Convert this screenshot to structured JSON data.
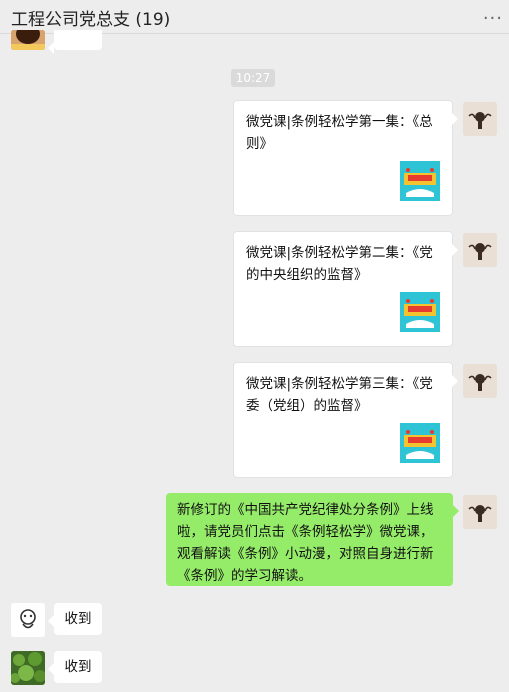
{
  "header": {
    "title": "工程公司党总支 (19)",
    "more_icon": "more-dots-icon"
  },
  "timestamp": "10:27",
  "messages": [
    {
      "text": "微党课|条例轻松学第一集：《总则》",
      "thumbnail_icon": "course-thumbnail-icon"
    },
    {
      "text": "微党课|条例轻松学第二集：《党的中央组织的监督》",
      "thumbnail_icon": "course-thumbnail-icon"
    },
    {
      "text": "微党课|条例轻松学第三集：《党委（党组）的监督》",
      "thumbnail_icon": "course-thumbnail-icon"
    },
    {
      "text": "新修订的《中国共产党纪律处分条例》上线啦，请党员们点击《条例轻松学》微党课，观看解读《条例》小动漫，对照自身进行新《条例》的学习解读。"
    },
    {
      "text": "收到"
    },
    {
      "text": "收到"
    }
  ],
  "colors": {
    "background": "#ededed",
    "my_bubble": "#95ec69",
    "thumb_bg": "#2ec4d6"
  }
}
